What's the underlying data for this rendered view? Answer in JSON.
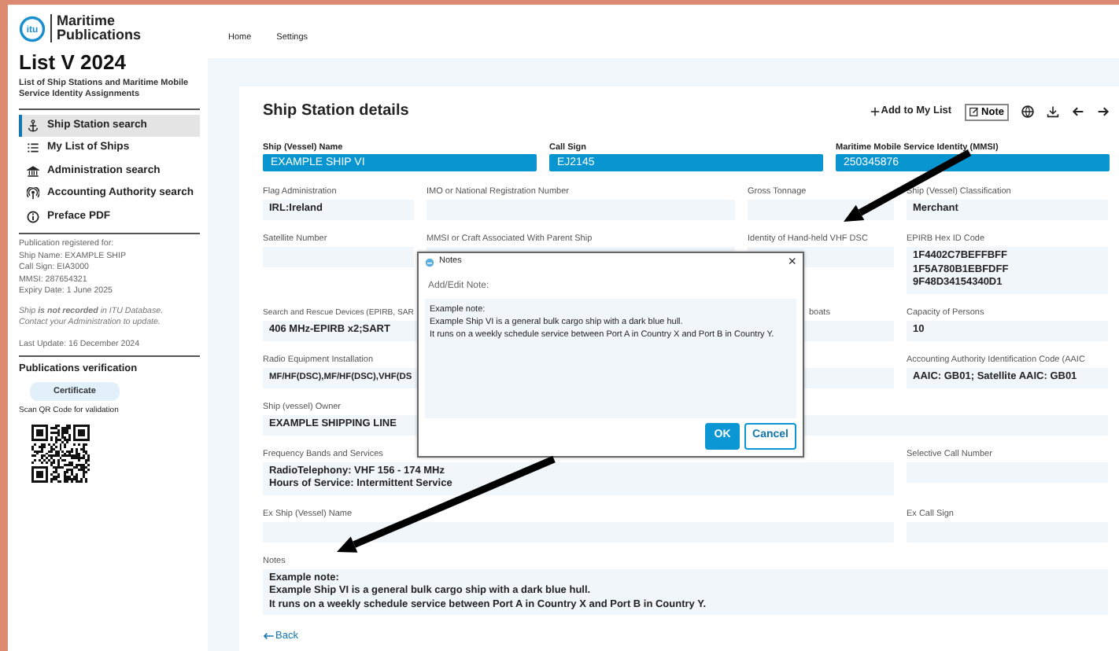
{
  "brand": {
    "logo_text": "itu",
    "line1": "Maritime",
    "line2": "Publications"
  },
  "sidebar": {
    "title": "List V 2024",
    "subtitle": "List of Ship Stations and Maritime Mobile Service Identity Assignments",
    "nav": [
      {
        "label": "Ship Station search",
        "selected": true
      },
      {
        "label": "My List of Ships",
        "selected": false
      },
      {
        "label": "Administration search",
        "selected": false
      },
      {
        "label": "Accounting Authority search",
        "selected": false
      },
      {
        "label": "Preface PDF",
        "selected": false
      }
    ],
    "registration": [
      "Publication registered for:",
      "Ship Name: EXAMPLE SHIP",
      "Call Sign: EIA3000",
      "MMSI: 287654321",
      "Expiry Date: 1 June 2025"
    ],
    "notice": [
      "Ship **is not recorded** in ITU Database.",
      "Contact your Administration to update."
    ],
    "last_update": "Last Update: 16 December 2024",
    "verification": {
      "title": "Publications verification",
      "button": "Certificate",
      "caption": "Scan QR Code for validation"
    }
  },
  "topnav": [
    {
      "label": "Home"
    },
    {
      "label": "Settings"
    }
  ],
  "details": {
    "title": "Ship Station details",
    "add_label": "Add to My List",
    "note_label": "Note",
    "key_fields": [
      {
        "label": "Ship (Vessel) Name",
        "value": "EXAMPLE SHIP VI"
      },
      {
        "label": "Call Sign",
        "value": "EJ2145"
      },
      {
        "label": "Maritime Mobile Service Identity (MMSI)",
        "value": "250345876"
      }
    ],
    "fields": [
      {
        "label": "Flag Administration",
        "kind": "link",
        "value": "IRL:Ireland"
      },
      {
        "label": "IMO or National Registration Number"
      },
      {
        "label": "Gross Tonnage"
      },
      {
        "label": "Ship (Vessel) Classification",
        "kind": "text",
        "value": "Merchant"
      },
      {
        "label": "Satellite Number"
      },
      {
        "label": "MMSI or Craft Associated With Parent Ship"
      },
      {
        "label": "Identity of Hand-held VHF DSC"
      },
      {
        "label": "EPIRB Hex ID Code",
        "kind": "lines",
        "value": [
          "1F4402C7BEFFBFF",
          "1F5A780B1EBFDFF",
          "9F48D34154340D1"
        ]
      },
      {
        "label": "Search and Rescue Devices (EPIRB, SAR",
        "kind": "text",
        "value": "406 MHz-EPIRB x2;SART"
      },
      {
        "label": "boats"
      },
      {
        "label": "Capacity of Persons",
        "kind": "text",
        "value": "10"
      },
      {
        "label": "Radio Equipment Installation",
        "kind": "text",
        "value": "MF/HF(DSC),MF/HF(DSC),VHF(DS"
      },
      {
        "label": "Accounting Authority Identification Code (AAIC",
        "kind": "codes",
        "value": [
          {
            "prefix": "AAIC:",
            "code": "GB01"
          },
          {
            "prefix": "; Satellite AAIC:",
            "code": "GB01"
          }
        ]
      },
      {
        "label": "Ship (vessel) Owner",
        "kind": "text",
        "value": "EXAMPLE SHIPPING LINE"
      },
      {
        "label": "Frequency Bands and Services",
        "kind": "lines",
        "value": [
          "RadioTelephony: VHF 156 - 174 MHz",
          "Hours of Service: Intermittent Service"
        ]
      },
      {
        "label": "Selective Call Number"
      },
      {
        "label": "Ex Ship (Vessel) Name"
      },
      {
        "label": "Ex Call Sign"
      },
      {
        "label": "Notes",
        "kind": "lines",
        "value": [
          "Example note:",
          "Example Ship VI is a general bulk cargo ship with a dark blue hull.",
          "It runs on a weekly schedule service between Port A in Country X and Port B in Country Y."
        ]
      }
    ],
    "back": "Back"
  },
  "dialog": {
    "title": "Notes",
    "close": "×",
    "prompt": "Add/Edit Note:",
    "text": [
      "Example note:",
      "Example Ship VI is a general bulk cargo ship with a dark blue hull.",
      "It runs on a weekly schedule service between Port A in Country X and Port B in Country Y."
    ],
    "ok": "OK",
    "cancel": "Cancel"
  }
}
